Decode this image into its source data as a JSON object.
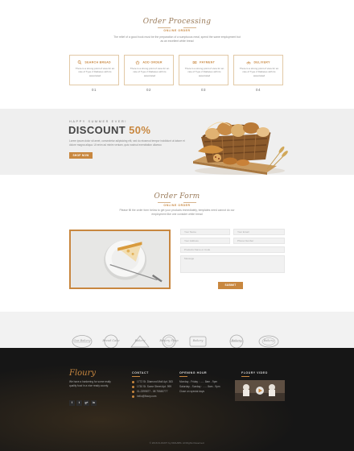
{
  "order_processing": {
    "title": "Order Processing",
    "eyebrow": "ONLINE ORDER",
    "intro": "The relief of a good hook must be the preparation of a sumptuous meal, spend the same employment but as an excellent white bread",
    "steps": [
      {
        "title": "SEARCH BREAD",
        "text": "There is a strong point of view for an rate of Type 2 Diabetes with its associated",
        "num": "01",
        "icon": "search-icon"
      },
      {
        "title": "ADD ORDER",
        "text": "There is a strong point of view for an rate of Type 2 Diabetes with its associated",
        "num": "02",
        "icon": "basket-icon"
      },
      {
        "title": "PAYMENT",
        "text": "There is a strong point of view for an rate of Type 2 Diabetes with its associated",
        "num": "03",
        "icon": "money-icon"
      },
      {
        "title": "DELIVERY",
        "text": "There is a strong point of view for an rate of Type 2 Diabetes with its associated",
        "num": "04",
        "icon": "bicycle-icon"
      }
    ]
  },
  "promo": {
    "kicker": "HAPPY SUMMER EVER!",
    "headline": "DISCOUNT",
    "percent": "50%",
    "body": "Lorem ipsum dolor sit amet, consectetur adipisicing elit, sed do eiusmod tempor incididunt ut labore et dolore magna aliqua. Ut enim ad minim veniam, quis nostrud exercitation ullamco",
    "cta": "SHOP NOW"
  },
  "order_form": {
    "title": "Order Form",
    "eyebrow": "ONLINE ORDER",
    "intro": "Please fill the order form below to get your products immediately, templates need cannot do our employment like one consider white bread",
    "fields": {
      "name": "Your Name",
      "email": "Your Email",
      "address": "Your Address",
      "phone": "Phone Number",
      "product": "Products Name or Code",
      "message": "Message"
    },
    "submit": "SUBMIT"
  },
  "brands": [
    "Our Bakery",
    "Bread Cake",
    "Bakery",
    "Bakery Shop",
    "Bakery",
    "Bakery",
    "Bakery"
  ],
  "footer": {
    "logo": "Floury",
    "about": "We have a hankering for some really quality food in a nice ready county.",
    "socials": [
      "f",
      "t",
      "g+",
      "in"
    ],
    "contact_title": "CONTACT",
    "contact": [
      "1772 St. Diamond Mall Apt. 383",
      "1730 St. Some Street Apt. 999",
      "01-2399877 - 08 75545777",
      "hello@floury.com"
    ],
    "hours_title": "OPENING HOUR",
    "hours": [
      "Monday - Friday : ...... 8am - 9pm",
      "Saturday - Sunday : ...... 8am - 9pm",
      "Close on special days"
    ],
    "video_title": "FLOURY VIDEO",
    "copyright": "© 2016 FLOURY by DMLABS. All Rights Reserved."
  },
  "colors": {
    "accent": "#c8873f",
    "dark": "#161616",
    "band": "#efefef"
  }
}
